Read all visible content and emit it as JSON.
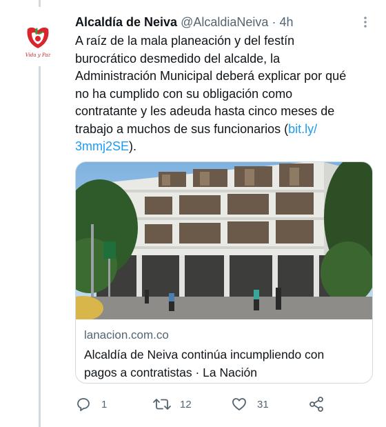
{
  "tweet": {
    "author_name": "Alcaldía de Neiva",
    "handle": "@AlcaldiaNeiva",
    "separator": "·",
    "time": "4h",
    "avatar_caption": "Vida y Paz",
    "text_lines": [
      "A raíz de la mala planeación y del festín",
      "burocrático desmedido del alcalde, la",
      "Administración Municipal deberá explicar por qué",
      "no ha cumplido con su obligación como",
      "contratante y les adeuda hasta cinco meses de",
      "trabajo a muchos de sus funcionarios ("
    ],
    "link_part1": "bit.ly/",
    "link_part2": "3mmj2SE",
    "text_end": ")."
  },
  "card": {
    "domain": "lanacion.com.co",
    "title_lines": [
      "Alcaldía de Neiva continúa incumpliendo con",
      "pagos a contratistas · La Nación"
    ]
  },
  "actions": {
    "reply_count": "1",
    "retweet_count": "12",
    "like_count": "31"
  },
  "colors": {
    "text": "#0f1419",
    "secondary": "#536471",
    "link": "#1d9bf0",
    "border": "#cfd9de",
    "logo_red": "#c0262a"
  },
  "icons": [
    "more-icon",
    "reply-icon",
    "retweet-icon",
    "like-icon",
    "share-icon"
  ]
}
